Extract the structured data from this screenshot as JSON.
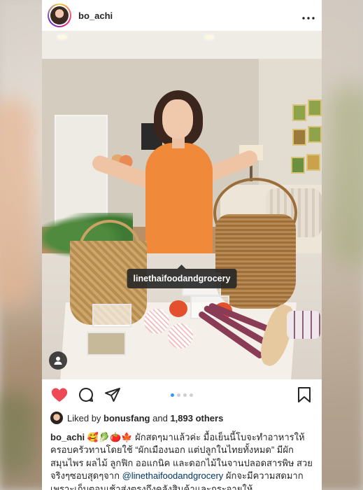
{
  "post": {
    "username": "bo_achi",
    "photo_tag": "linethaifoodandgrocery",
    "carousel": {
      "count": 4,
      "active_index": 0
    },
    "liked_by": {
      "prefix": "Liked by",
      "user": "bonusfang",
      "joiner": "and",
      "others": "1,893 others"
    },
    "caption": {
      "username": "bo_achi",
      "emojis": "🥰🥬🍅🍁",
      "text_part1": " ผักสดๆมาแล้วค่ะ มื้อเย็นนี้โบจะทำอาหารให้ครอบครัวทานโดยใช้ “ผักเมืองนอก แต่ปลูกในไทยทั้งหมด” มีผัก สมุนไพร ผลไม้ ลูกฟิก ออแกนิค และดอกไม้ในจานปลอดสารพิษ สวยจริงๆซอบสุดๆจาก ",
      "mention": "@linethaifoodandgrocery",
      "text_part2": " ผักจะมีความสดมาก เพราะเก็บตอนเช้าส่งตรงถึงคลังสินค้าและกระจายให้"
    }
  },
  "colors": {
    "heart": "#ed4956",
    "accent_dot": "#3897f0",
    "tag_bg": "#262626"
  },
  "icons": [
    "more-icon",
    "user-tag-icon",
    "heart-icon",
    "comment-icon",
    "share-icon",
    "bookmark-icon"
  ]
}
